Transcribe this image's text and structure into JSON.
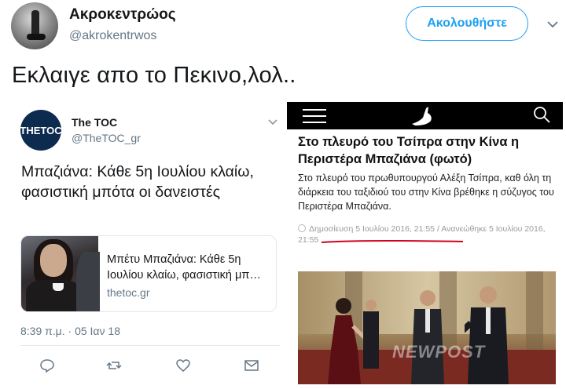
{
  "author": {
    "name": "Ακροκεντρώος",
    "handle": "@akrokentrwos",
    "follow_label": "Ακολουθήστε"
  },
  "tweet": {
    "text": "Εκλαιγε απο το Πεκινο,λολ.."
  },
  "quoted_tweet": {
    "logo_text": "THETOC",
    "name": "The TOC",
    "handle": "@TheTOC_gr",
    "text": "Μπαζιάνα: Κάθε 5η Ιουλίου κλαίω, φασιστική μπότα οι δανειστές",
    "link_card": {
      "title": "Μπέτυ Μπαζιάνα: Κάθε 5η Ιουλίου κλαίω, φασιστική μπ…",
      "domain": "thetoc.gr"
    },
    "timestamp": "8:39 π.μ. · 05 Ιαν 18"
  },
  "article_screenshot": {
    "title": "Στο πλευρό του Τσίπρα στην Κίνα η Περιστέρα Μπαζιάνα (φωτό)",
    "body": "Στο πλευρό του πρωθυπουργού Αλέξη Τσίπρα, καθ όλη τη διάρκεια του ταξιδιού του στην Κίνα βρέθηκε η σύζυγος του Περιστέρα Μπαζιάνα.",
    "meta": "Δημοσίευση 5 Ιουλίου 2016, 21:55 / Ανανεώθηκε 5 Ιουλίου 2016, 21:55",
    "watermark": "NEWPOST"
  },
  "colors": {
    "accent": "#1da1f2",
    "secondary_text": "#657786",
    "underline": "#d0021b"
  },
  "icons": {
    "caret": "chevron-down-icon",
    "reply": "reply-icon",
    "retweet": "retweet-icon",
    "like": "heart-icon",
    "dm": "envelope-icon"
  }
}
